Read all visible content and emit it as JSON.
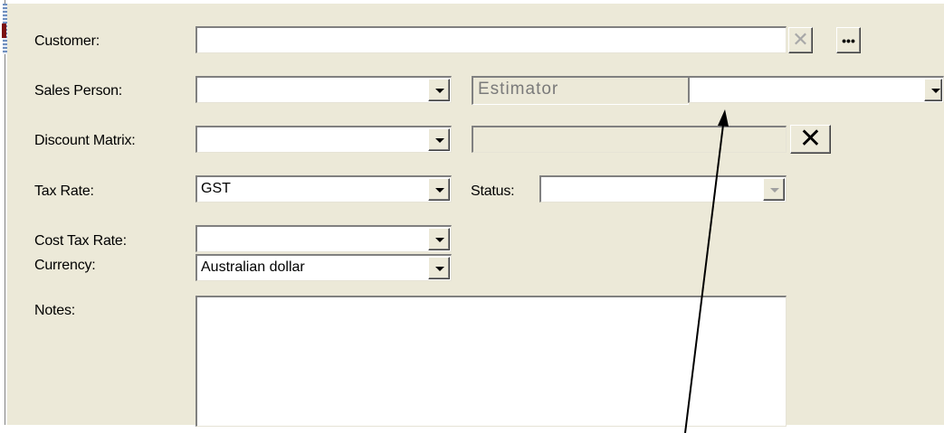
{
  "form": {
    "customer": {
      "label": "Customer:",
      "value": "",
      "clear_icon": "x-icon",
      "browse_label": "•••"
    },
    "sales_person": {
      "label": "Sales Person:",
      "value": ""
    },
    "estimator": {
      "label": "Estimator",
      "value": ""
    },
    "discount_matrix": {
      "label": "Discount Matrix:",
      "value": "",
      "extra_value": "",
      "clear_icon": "x-icon"
    },
    "tax_rate": {
      "label": "Tax Rate:",
      "value": "GST"
    },
    "status": {
      "label": "Status:",
      "value": ""
    },
    "cost_tax_rate": {
      "label": "Cost Tax Rate:",
      "value": ""
    },
    "currency": {
      "label": "Currency:",
      "value": "Australian dollar"
    },
    "notes": {
      "label": "Notes:",
      "value": ""
    }
  },
  "annotation": {
    "icon": "arrow-icon",
    "color": "#000000"
  }
}
